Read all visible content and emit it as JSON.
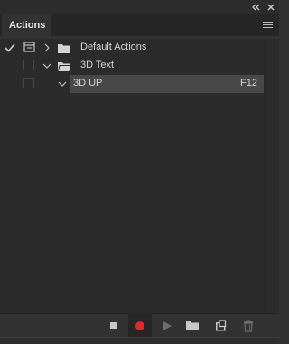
{
  "panel": {
    "title": "Actions",
    "window_controls": [
      "collapse-icon",
      "close-icon"
    ],
    "menu_icon": "panel-menu-icon"
  },
  "actions": [
    {
      "label": "Default Actions",
      "checked": true,
      "expanded": false,
      "icon": "folder-icon",
      "level": 0
    },
    {
      "label": "3D Text",
      "checked": false,
      "expanded": true,
      "icon": "folder-icon",
      "level": 0
    },
    {
      "label": "3D UP",
      "checked": false,
      "expanded": true,
      "shortcut": "F12",
      "level": 1,
      "selected": true
    }
  ],
  "footer": {
    "buttons": [
      "stop-icon",
      "record-icon",
      "play-icon",
      "new-set-icon",
      "new-action-icon",
      "delete-icon"
    ],
    "record_color": "#e0282e"
  },
  "colors": {
    "panel_bg": "#323232",
    "list_bg": "#2b2b2b",
    "selected_row": "#484848"
  }
}
